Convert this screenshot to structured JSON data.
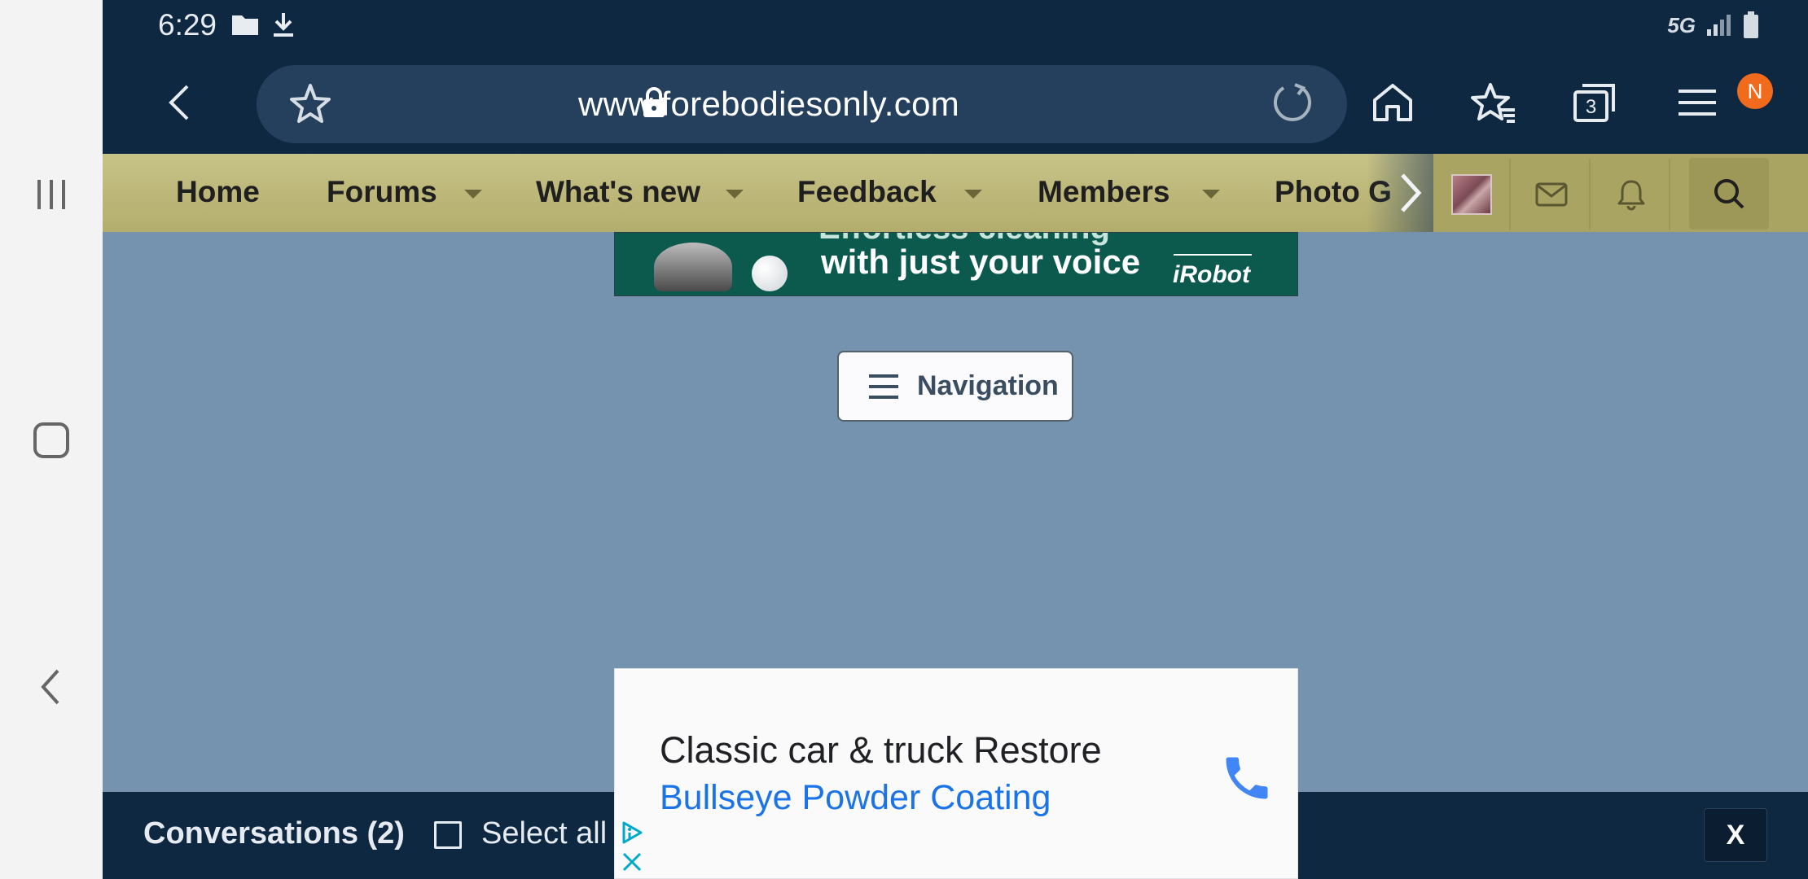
{
  "status_bar": {
    "time": "6:29",
    "network": "5G",
    "icons": [
      "folder-icon",
      "download-icon",
      "signal-icon",
      "battery-icon"
    ]
  },
  "browser": {
    "url": "www.forebodiesonly.com",
    "tab_count": "3",
    "profile_badge": "N",
    "icons": [
      "back-icon",
      "forward-icon",
      "bookmark-star-icon",
      "lock-icon",
      "reload-icon",
      "home-icon",
      "bookmarks-icon",
      "tabs-icon",
      "menu-icon"
    ]
  },
  "site_nav": {
    "items": [
      {
        "label": "Home"
      },
      {
        "label": "Forums"
      },
      {
        "label": "What's new"
      },
      {
        "label": "Feedback"
      },
      {
        "label": "Members"
      },
      {
        "label": "Photo G"
      }
    ]
  },
  "top_ad": {
    "line1": "Effortless cleaning",
    "line2": "with just your voice",
    "brand": "iRobot"
  },
  "navigation_button": {
    "label": "Navigation"
  },
  "bottom_bar": {
    "conversations": "Conversations (2)",
    "select_all": "Select all",
    "close": "X"
  },
  "bottom_ad": {
    "headline": "Classic car & truck Restore",
    "advertiser": "Bullseye Powder Coating"
  },
  "colors": {
    "chrome": "#0f2841",
    "page_bg": "#7593af",
    "nav_bg": "#b3ad6d",
    "badge": "#f26b1d",
    "ad_link": "#1a73e8"
  }
}
